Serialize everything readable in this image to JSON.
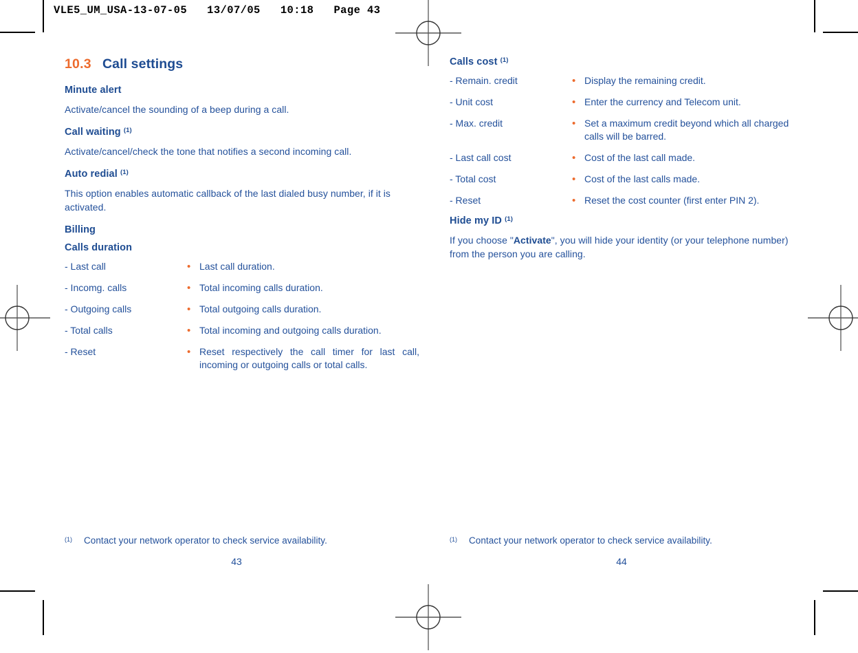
{
  "print_header": "VLE5_UM_USA-13-07-05   13/07/05   10:18   Page 43",
  "colors": {
    "heading_blue": "#1E4C92",
    "body_blue": "#24519B",
    "accent_orange": "#ED6B2D",
    "crop_black": "#000000"
  },
  "left_page": {
    "section": {
      "number": "10.3",
      "title": "Call settings"
    },
    "blocks": [
      {
        "heading": "Minute alert",
        "footnote": ""
      },
      {
        "paragraph": "Activate/cancel the sounding of a beep during a call."
      },
      {
        "heading": "Call waiting",
        "footnote": "(1)"
      },
      {
        "paragraph": "Activate/cancel/check the tone that notifies a second incoming call."
      },
      {
        "heading": "Auto redial",
        "footnote": "(1)"
      },
      {
        "paragraph": "This option enables automatic callback of the last dialed busy number, if it is activated."
      },
      {
        "heading": "Billing",
        "footnote": ""
      },
      {
        "heading": "Calls duration",
        "footnote": ""
      }
    ],
    "options": [
      {
        "key": "- Last call",
        "bullet": "•",
        "value": "Last call duration."
      },
      {
        "key": "- Incomg. calls",
        "bullet": "•",
        "value": "Total incoming calls duration."
      },
      {
        "key": "- Outgoing calls",
        "bullet": "•",
        "value": "Total outgoing calls duration."
      },
      {
        "key": "- Total calls",
        "bullet": "•",
        "value": "Total incoming and outgoing calls duration."
      },
      {
        "key": "- Reset",
        "bullet": "•",
        "value": "Reset respectively the call timer for last call, incoming or outgoing calls or total calls."
      }
    ],
    "footnote": {
      "marker": "(1)",
      "text": "Contact your network operator to check service availability."
    },
    "folio": "43"
  },
  "right_page": {
    "heading_calls_cost": {
      "text": "Calls cost",
      "footnote": "(1)"
    },
    "options_cost": [
      {
        "key": "- Remain. credit",
        "bullet": "•",
        "value": "Display the remaining credit."
      },
      {
        "key": "- Unit cost",
        "bullet": "•",
        "value": "Enter the currency and Telecom unit."
      },
      {
        "key": "- Max. credit",
        "bullet": "•",
        "value": "Set a maximum credit beyond which all charged calls will be barred."
      },
      {
        "key": "- Last call cost",
        "bullet": "•",
        "value": "Cost of the last call made."
      },
      {
        "key": "- Total cost",
        "bullet": "•",
        "value": "Cost of the last calls made."
      },
      {
        "key": "- Reset",
        "bullet": "•",
        "value": "Reset the cost counter (first enter PIN 2)."
      }
    ],
    "heading_hide_my_id": {
      "text": "Hide my ID",
      "footnote": "(1)"
    },
    "hide_my_id_paragraph": {
      "before": "If you choose \"",
      "bold": "Activate",
      "after": "\", you will hide your identity (or your telephone number) from the person you are calling."
    },
    "footnote": {
      "marker": "(1)",
      "text": "Contact your network operator to check service availability."
    },
    "folio": "44"
  }
}
